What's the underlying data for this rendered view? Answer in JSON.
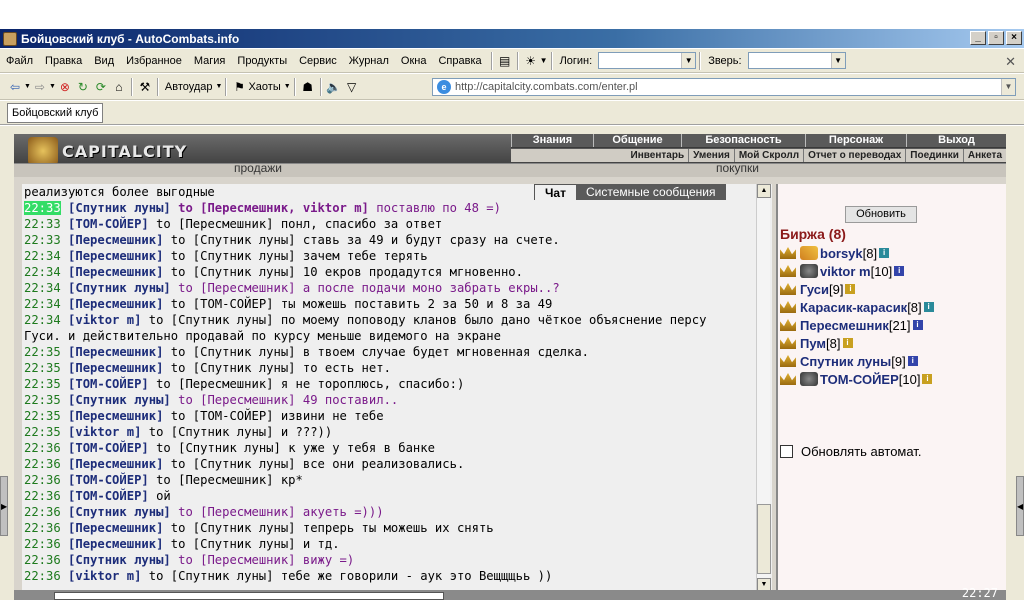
{
  "window": {
    "title": "Бойцовский клуб - AutoCombats.info"
  },
  "menu": {
    "items": [
      "Файл",
      "Правка",
      "Вид",
      "Избранное",
      "Магия",
      "Продукты",
      "Сервис",
      "Журнал",
      "Окна",
      "Справка"
    ],
    "login_label": "Логин:",
    "login_value": "",
    "pet_label": "Зверь:",
    "pet_value": ""
  },
  "toolbar": {
    "autoudar_label": "Автоудар",
    "haoty_label": "Хаоты",
    "address": "http://capitalcity.combats.com/enter.pl"
  },
  "tabs": [
    "Бойцовский клуб"
  ],
  "game": {
    "brand": "CAPITALCITY",
    "nav_primary": [
      "Знания",
      "Общение",
      "Безопасность",
      "Персонаж",
      "Выход"
    ],
    "nav_secondary": [
      "Инвентарь",
      "Умения",
      "Мой Скролл",
      "Отчет о переводах",
      "Поединки",
      "Анкета"
    ],
    "strip_left": "продажи",
    "strip_right": "покупки",
    "chat_tab_active": "Чат",
    "chat_tab_system": "Системные сообщения"
  },
  "chat": [
    {
      "time": "",
      "from": "",
      "to": "",
      "text": "реализуются более выгодные",
      "kind": "cont",
      "hl": false
    },
    {
      "time": "22:33",
      "from": "[Спутник луны]",
      "to": "to [Пересмешник, viktor m]",
      "text": "поставлю по 48 =)",
      "kind": "priv",
      "hl": true
    },
    {
      "time": "22:33",
      "from": "[ТОМ-СОЙЕР]",
      "to": "to [Пересмешник]",
      "text": "понл, спасибо за ответ",
      "kind": "pub",
      "hl": false
    },
    {
      "time": "22:33",
      "from": "[Пересмешник]",
      "to": "to [Спутник луны]",
      "text": "ставь за 49 и будут сразу на счете.",
      "kind": "pub",
      "hl": false
    },
    {
      "time": "22:34",
      "from": "[Пересмешник]",
      "to": "to [Спутник луны]",
      "text": "зачем тебе терять",
      "kind": "pub",
      "hl": false
    },
    {
      "time": "22:34",
      "from": "[Пересмешник]",
      "to": "to [Спутник луны]",
      "text": "10 екров продадутся мгновенно.",
      "kind": "pub",
      "hl": false
    },
    {
      "time": "22:34",
      "from": "[Спутник луны]",
      "to": "to [Пересмешник]",
      "text": "а после подачи моно забрать екры..?",
      "kind": "priv2",
      "hl": false
    },
    {
      "time": "22:34",
      "from": "[Пересмешник]",
      "to": "to [ТОМ-СОЙЕР]",
      "text": "ты можешь поставить 2 за 50 и 8 за 49",
      "kind": "pub",
      "hl": false
    },
    {
      "time": "22:34",
      "from": "[viktor m]",
      "to": "to [Спутник луны]",
      "text": "по моему поповоду кланов было дано чёткое объяснение персу",
      "kind": "pub",
      "hl": false
    },
    {
      "time": "",
      "from": "",
      "to": "",
      "text": "Гуси. и действительно продавай по курсу меньше видемого на экране",
      "kind": "cont",
      "hl": false
    },
    {
      "time": "22:35",
      "from": "[Пересмешник]",
      "to": "to [Спутник луны]",
      "text": "в твоем случае будет мгновенная сделка.",
      "kind": "pub",
      "hl": false
    },
    {
      "time": "22:35",
      "from": "[Пересмешник]",
      "to": "to [Спутник луны]",
      "text": "то есть нет.",
      "kind": "pub",
      "hl": false
    },
    {
      "time": "22:35",
      "from": "[ТОМ-СОЙЕР]",
      "to": "to [Пересмешник]",
      "text": "я не тороплюсь, спасибо:)",
      "kind": "pub",
      "hl": false
    },
    {
      "time": "22:35",
      "from": "[Спутник луны]",
      "to": "to [Пересмешник]",
      "text": "49 поставил..",
      "kind": "priv2",
      "hl": false
    },
    {
      "time": "22:35",
      "from": "[Пересмешник]",
      "to": "to [ТОМ-СОЙЕР]",
      "text": "извини не тебе",
      "kind": "pub",
      "hl": false
    },
    {
      "time": "22:35",
      "from": "[viktor m]",
      "to": "to [Спутник луны]",
      "text": "и ???))",
      "kind": "pub",
      "hl": false
    },
    {
      "time": "22:36",
      "from": "[ТОМ-СОЙЕР]",
      "to": "to [Спутник луны]",
      "text": "к уже у тебя в банке",
      "kind": "pub",
      "hl": false
    },
    {
      "time": "22:36",
      "from": "[Пересмешник]",
      "to": "to [Спутник луны]",
      "text": "все они реализовались.",
      "kind": "pub",
      "hl": false
    },
    {
      "time": "22:36",
      "from": "[ТОМ-СОЙЕР]",
      "to": "to [Пересмешник]",
      "text": "кр*",
      "kind": "pub",
      "hl": false
    },
    {
      "time": "22:36",
      "from": "[ТОМ-СОЙЕР]",
      "to": "",
      "text": "ой",
      "kind": "pub",
      "hl": false
    },
    {
      "time": "22:36",
      "from": "[Спутник луны]",
      "to": "to [Пересмешник]",
      "text": "акуеть =)))",
      "kind": "priv2",
      "hl": false
    },
    {
      "time": "22:36",
      "from": "[Пересмешник]",
      "to": "to [Спутник луны]",
      "text": "тепрерь ты можешь их снять",
      "kind": "pub",
      "hl": false
    },
    {
      "time": "22:36",
      "from": "[Пересмешник]",
      "to": "to [Спутник луны]",
      "text": "и тд.",
      "kind": "pub",
      "hl": false
    },
    {
      "time": "22:36",
      "from": "[Спутник луны]",
      "to": "to [Пересмешник]",
      "text": "вижу =)",
      "kind": "priv2",
      "hl": false
    },
    {
      "time": "22:36",
      "from": "[viktor m]",
      "to": "to [Спутник луны]",
      "text": "тебе же говорили - аук это Вещщщьь ))",
      "kind": "pub",
      "hl": false
    }
  ],
  "panel": {
    "refresh_label": "Обновить",
    "exchange_title": "Биржа (8)",
    "users": [
      {
        "name": "borsyk",
        "level": "[8]",
        "badge": "i",
        "badge_color": "teal"
      },
      {
        "name": "viktor m",
        "level": "[10]",
        "badge": "i",
        "badge_color": "blue"
      },
      {
        "name": "Гуси",
        "level": "[9]",
        "badge": "i",
        "badge_color": "gold"
      },
      {
        "name": "Карасик-карасик",
        "level": "[8]",
        "badge": "i",
        "badge_color": "teal"
      },
      {
        "name": "Пересмешник",
        "level": "[21]",
        "badge": "i",
        "badge_color": "blue"
      },
      {
        "name": "Пум",
        "level": "[8]",
        "badge": "i",
        "badge_color": "gold"
      },
      {
        "name": "Спутник луны",
        "level": "[9]",
        "badge": "i",
        "badge_color": "blue"
      },
      {
        "name": "ТОМ-СОЙЕР",
        "level": "[10]",
        "badge": "i",
        "badge_color": "gold"
      }
    ],
    "auto_refresh_label": "Обновлять автомат."
  },
  "status": {
    "clock": "22:27"
  }
}
